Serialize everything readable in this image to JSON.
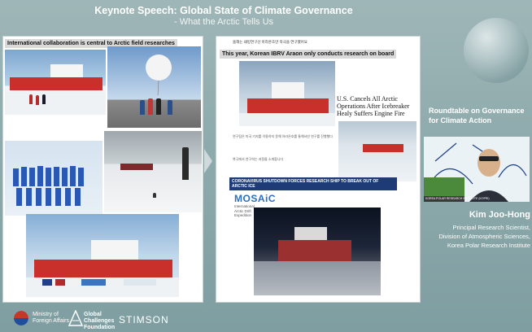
{
  "header": {
    "title": "Keynote Speech: Global State of Climate Governance",
    "subtitle": "- What the Arctic Tells Us"
  },
  "slide_left": {
    "heading": "International collaboration is central to Arctic field researches"
  },
  "slide_right": {
    "korean_title": "올해는 쇄빙연구선 아라온호만 북극을 연구했어요",
    "heading": "This year, Korean IBRV Araon only conducts research on board",
    "news_headline": "U.S. Cancels All Arctic Operations After Icebreaker Healy Suffers Engine Fire",
    "korean_caption": "연구팀은 미국 기지를 이용하지 못해 아라온호를 통해서만 연구를 진행했다",
    "korean_note": "북극에서 연구하는 과정을 소개합니다",
    "mosaic_caption": "CORONAVIRUS SHUTDOWN FORCES RESEARCH SHIP TO BREAK OUT OF ARCTIC ICE",
    "mosaic_logo": "MOSAiC",
    "mosaic_logo_sub": "International Arctic Drift Expedition"
  },
  "panel": {
    "roundtable_title": "Roundtable on Governance for Climate Action",
    "speaker_name": "Kim Joo-Hong",
    "speaker_role": "Principal Research Scientist,\nDivision of Atmospheric Sciences,\nKorea Polar Research Institute",
    "speaker_tag": "KOREA POLAR RESEARCH INSTITUTE (KOPRI)"
  },
  "footer": {
    "mofa": "Ministry of\nForeign Affairs",
    "gcf": "Global\nChallenges\nFoundation",
    "stimson": "STIMSON"
  },
  "icons": [
    "ship-icon",
    "balloon-icon",
    "arrow-right-icon",
    "globe-icon",
    "mofa-logo-icon",
    "gcf-logo-icon"
  ]
}
